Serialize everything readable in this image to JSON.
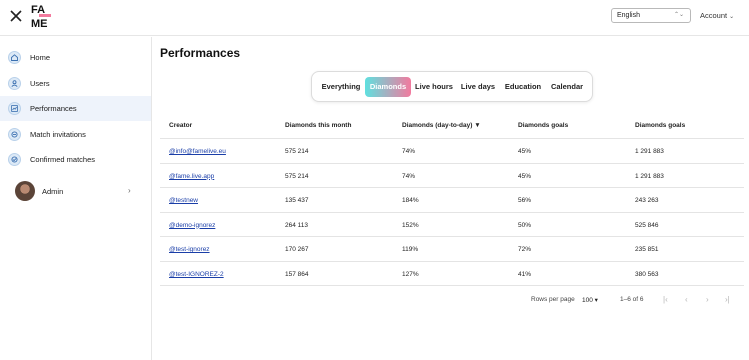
{
  "topbar": {
    "language": "English",
    "account_label": "Account"
  },
  "sidebar": {
    "items": [
      {
        "label": "Home",
        "icon": "home-icon",
        "active": false
      },
      {
        "label": "Users",
        "icon": "user-icon",
        "active": false
      },
      {
        "label": "Performances",
        "icon": "chart-icon",
        "active": true
      },
      {
        "label": "Match invitations",
        "icon": "invite-icon",
        "active": false
      },
      {
        "label": "Confirmed matches",
        "icon": "match-icon",
        "active": false
      }
    ],
    "admin_label": "Admin"
  },
  "main": {
    "title": "Performances",
    "tabs": [
      {
        "label": "Everything",
        "active": false
      },
      {
        "label": "Diamonds",
        "active": true
      },
      {
        "label": "Live hours",
        "active": false
      },
      {
        "label": "Live days",
        "active": false
      },
      {
        "label": "Education",
        "active": false
      },
      {
        "label": "Calendar",
        "active": false
      }
    ],
    "table": {
      "columns": [
        "Creator",
        "Diamonds this month",
        "Diamonds (day-to-day)",
        "Diamonds goals",
        "Diamonds goals"
      ],
      "sort_indicator": "▼",
      "rows": [
        [
          "@info@famelive.eu",
          "575 214",
          "74%",
          "45%",
          "1 291 883"
        ],
        [
          "@fame.live.app",
          "575 214",
          "74%",
          "45%",
          "1 291 883"
        ],
        [
          "@testnew",
          "135 437",
          "184%",
          "56%",
          "243 263"
        ],
        [
          "@demo-ignorez",
          "264 113",
          "152%",
          "50%",
          "525 846"
        ],
        [
          "@test-ignorez",
          "170 267",
          "119%",
          "72%",
          "235 851"
        ],
        [
          "@test-IGNOREZ-2",
          "157 864",
          "127%",
          "41%",
          "380 563"
        ]
      ]
    },
    "pagination": {
      "rows_per_page_label": "Rows per page",
      "rows_per_page_value": "100",
      "range_text": "1–6 of 6"
    }
  },
  "colors": {
    "active_tab_gradient_start": "#5fe0df",
    "active_tab_gradient_end": "#f27a9e",
    "link": "#1a3ea8",
    "sidebar_active_bg": "#eef3fb"
  }
}
